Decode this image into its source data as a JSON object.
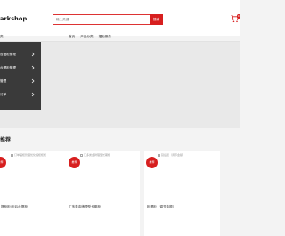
{
  "header": {
    "logo": "arkshop",
    "search_placeholder": "输入关键",
    "search_button": "搜索",
    "cart_count": "0"
  },
  "nav": {
    "label": "类",
    "items": [
      "首页",
      "产品分类",
      "摆柜服务"
    ]
  },
  "category_menu": {
    "items": [
      "台摆柜管理",
      "台摆柜管理",
      "管理",
      "订单",
      "柜"
    ]
  },
  "section": {
    "title": "推荐"
  },
  "products": [
    {
      "image_alt": "订单摆柜管理优化摆柜柜柜",
      "badge": "推荐",
      "name": "摆柜柜/柜后台摆柜"
    },
    {
      "image_alt": "汇多类金牌理型长期柜",
      "badge": "推荐",
      "name": "汇多类金牌理型长期柜"
    },
    {
      "image_alt": "延后柜（调节金额）",
      "badge": "推荐",
      "name": "柜摆柜（调节金额）"
    }
  ],
  "colors": {
    "accent": "#d71f1f",
    "menu_bg": "#3a3a3a"
  }
}
